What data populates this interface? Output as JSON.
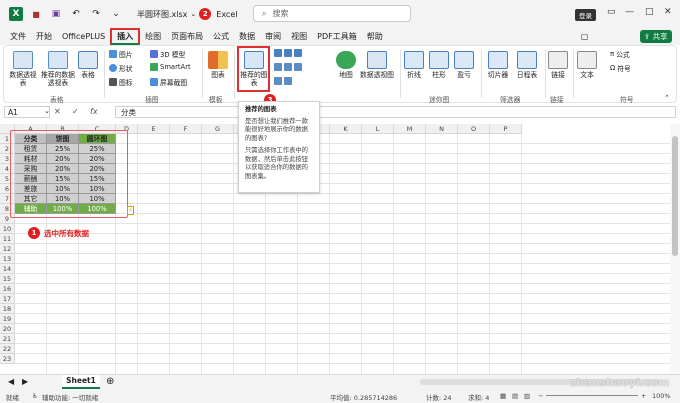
{
  "titlebar": {
    "filename": "半圆环图.xlsx",
    "app": "Excel",
    "search_placeholder": "搜索",
    "login": "登录",
    "step2": "2"
  },
  "tabs": [
    "文件",
    "开始",
    "OfficePLUS",
    "插入",
    "绘图",
    "页面布局",
    "公式",
    "数据",
    "审阅",
    "视图",
    "PDF工具箱",
    "帮助"
  ],
  "share": "共享",
  "ribbon": {
    "pivot": "数据透视表",
    "recpivot": "推荐的数据透视表",
    "table": "表格",
    "grp_table": "表格",
    "pictures": "图片",
    "shapes": "形状",
    "icons": "图标",
    "model3d": "3D 模型",
    "smartart": "SmartArt",
    "screenshot": "屏幕截图",
    "grp_illus": "插图",
    "chart": "图表",
    "grp_template": "模板",
    "rec_chart": "推荐的图表",
    "step3": "3",
    "maps": "地图",
    "pivotchart": "数据透视图",
    "line": "折线",
    "column": "柱形",
    "winloss": "盈亏",
    "grp_spark": "迷你图",
    "slicer": "切片器",
    "timeline": "日程表",
    "grp_filter": "筛选器",
    "link": "链接",
    "grp_link": "链接",
    "text": "文本",
    "formula": "公式",
    "symbol": "符号",
    "grp_symbol": "符号"
  },
  "formula": {
    "namebox": "A1",
    "fx": "fx",
    "value": "分类"
  },
  "columns": [
    "A",
    "B",
    "C",
    "D",
    "E",
    "F",
    "G",
    "H",
    "I",
    "J",
    "K",
    "L",
    "M",
    "N",
    "O",
    "P"
  ],
  "rows": [
    "1",
    "2",
    "3",
    "4",
    "5",
    "6",
    "7",
    "8",
    "9",
    "10",
    "11",
    "12",
    "13",
    "14",
    "15",
    "16",
    "17",
    "18",
    "19",
    "20",
    "21",
    "22",
    "23"
  ],
  "table": {
    "header": [
      "分类",
      "饼图",
      "圆环图"
    ],
    "data": [
      [
        "租赁",
        "25%",
        "25%"
      ],
      [
        "耗材",
        "20%",
        "20%"
      ],
      [
        "采购",
        "20%",
        "20%"
      ],
      [
        "薪酬",
        "15%",
        "15%"
      ],
      [
        "差旅",
        "10%",
        "10%"
      ],
      [
        "其它",
        "10%",
        "10%"
      ],
      [
        "辅助",
        "100%",
        "100%"
      ]
    ]
  },
  "annotation": {
    "num": "1",
    "text": "选中所有数据"
  },
  "tooltip": {
    "title": "推荐的图表",
    "p1": "是否想让我们推荐一款能很好地展示你的数据的图表?",
    "p2": "只需选择你工作表中的数据，然后单击此按钮以获取适合你的数据的图表集。"
  },
  "sheet": "Sheet1",
  "status": {
    "ready": "就绪",
    "access": "辅助功能: 一切就绪",
    "avg": "平均值: 0.285714286",
    "count": "计数: 24",
    "sum": "求和: 4",
    "zoom": "100%"
  },
  "watermark": "zhanshaoyi.com",
  "colors": {
    "green": "#107c41",
    "red": "#e02020",
    "header_gray": "#a6a6a6",
    "cell_gray": "#d0d0d0",
    "helper_green": "#70ad47"
  }
}
